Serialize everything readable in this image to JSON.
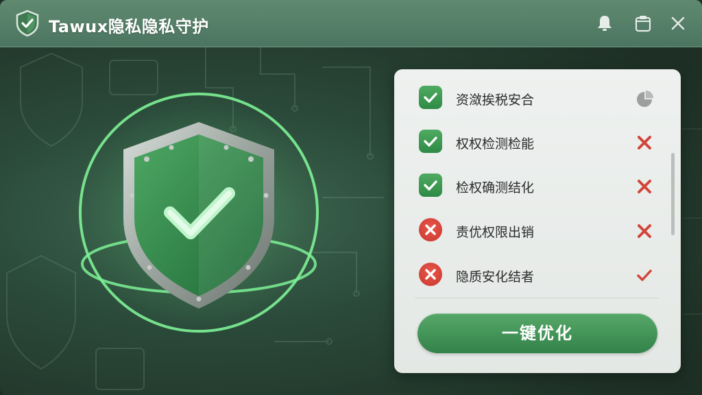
{
  "app": {
    "title": "Tawux隐私隐私守护",
    "logo_icon": "shield-check-icon"
  },
  "titlebar": {
    "buttons": [
      {
        "name": "notifications",
        "icon": "bell-icon"
      },
      {
        "name": "clipboard",
        "icon": "clipboard-icon"
      },
      {
        "name": "close",
        "icon": "close-icon"
      }
    ]
  },
  "hero": {
    "icon": "shield-check-icon",
    "accent": "#5ee07a"
  },
  "checklist": {
    "items": [
      {
        "label": "资潋挨税安合",
        "state": "ok",
        "status_icon": "pie-progress-icon"
      },
      {
        "label": "权权检测检能",
        "state": "ok",
        "status_icon": "x-icon"
      },
      {
        "label": "检权确测结化",
        "state": "ok",
        "status_icon": "x-icon"
      },
      {
        "label": "责优权限出销",
        "state": "error",
        "status_icon": "x-icon"
      },
      {
        "label": "隐质安化结者",
        "state": "error",
        "status_icon": "check-icon"
      }
    ],
    "optimize_label": "一键优化"
  },
  "colors": {
    "ok": "#3a9650",
    "error": "#d2453a",
    "titlebar": "#577f67"
  }
}
